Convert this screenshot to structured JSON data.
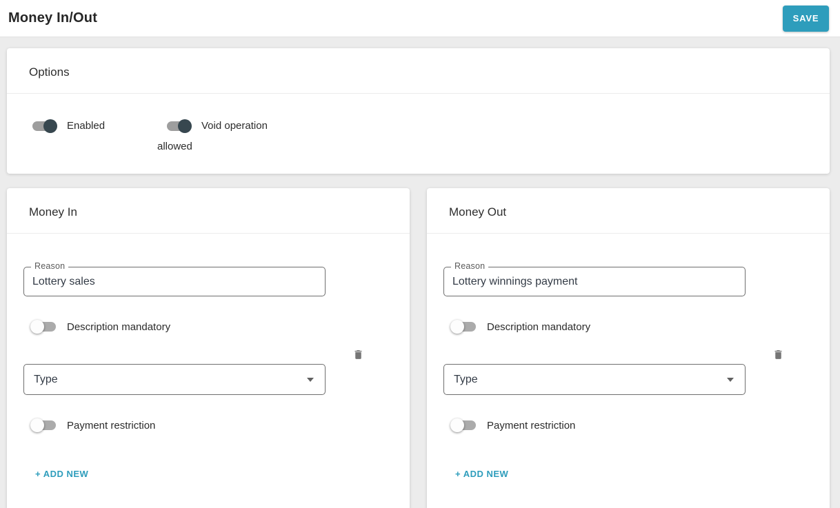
{
  "colors": {
    "accent": "#2e9dbc",
    "knob_on": "#37474f",
    "track": "#9e9e9e",
    "icon_gray": "#757575"
  },
  "header": {
    "title": "Money In/Out",
    "save_label": "SAVE"
  },
  "options": {
    "title": "Options",
    "enabled_toggle": {
      "label": "Enabled",
      "on": true
    },
    "void_toggle": {
      "label": "Void operation allowed",
      "on": true
    }
  },
  "sections": [
    {
      "title": "Money In",
      "reason": {
        "label": "Reason",
        "value": "Lottery sales"
      },
      "description_toggle": {
        "label": "Description mandatory",
        "on": false
      },
      "type_select": {
        "value": "Type"
      },
      "payment_toggle": {
        "label": "Payment restriction",
        "on": false
      },
      "add_new_label": "+ ADD NEW"
    },
    {
      "title": "Money Out",
      "reason": {
        "label": "Reason",
        "value": "Lottery winnings payment"
      },
      "description_toggle": {
        "label": "Description mandatory",
        "on": false
      },
      "type_select": {
        "value": "Type"
      },
      "payment_toggle": {
        "label": "Payment restriction",
        "on": false
      },
      "add_new_label": "+ ADD NEW"
    }
  ]
}
